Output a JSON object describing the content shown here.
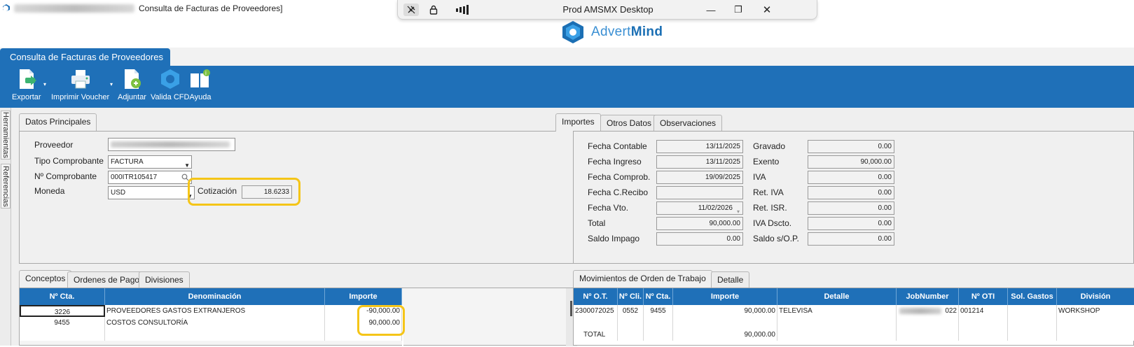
{
  "window": {
    "title": "Consulta de Facturas de Proveedores]"
  },
  "remote_bar": {
    "title": "Prod AMSMX Desktop",
    "minimize": "—",
    "restore": "❐",
    "close": "✕"
  },
  "logo": {
    "part1": "Advert",
    "part2": "Mind"
  },
  "doc_tab": {
    "label": "Consulta de Facturas de Proveedores"
  },
  "toolbar": {
    "exportar": "Exportar",
    "imprimir": "Imprimir Voucher",
    "adjuntar": "Adjuntar",
    "valida": "Valida CFD",
    "ayuda": "Ayuda"
  },
  "side_tabs": {
    "herramientas": "Herramientas",
    "referencias": "Referencias"
  },
  "datos": {
    "tab": "Datos Principales",
    "proveedor_label": "Proveedor",
    "tipo_label": "Tipo Comprobante",
    "tipo_value": "FACTURA",
    "num_label": "Nº Comprobante",
    "num_value": "000ITR105417",
    "moneda_label": "Moneda",
    "moneda_value": "USD",
    "cotizacion_label": "Cotización",
    "cotizacion_value": "18.6233"
  },
  "importes": {
    "tabs": [
      "Importes",
      "Otros Datos",
      "Observaciones"
    ],
    "left": [
      {
        "label": "Fecha Contable",
        "value": "13/11/2025"
      },
      {
        "label": "Fecha Ingreso",
        "value": "13/11/2025"
      },
      {
        "label": "Fecha Comprob.",
        "value": "19/09/2025"
      },
      {
        "label": "Fecha C.Recibo",
        "value": ""
      },
      {
        "label": "Fecha Vto.",
        "value": "11/02/2026"
      },
      {
        "label": "Total",
        "value": "90,000.00"
      },
      {
        "label": "Saldo Impago",
        "value": "0.00"
      }
    ],
    "right": [
      {
        "label": "Gravado",
        "value": "0.00"
      },
      {
        "label": "Exento",
        "value": "90,000.00"
      },
      {
        "label": "IVA",
        "value": "0.00"
      },
      {
        "label": "Ret. IVA",
        "value": "0.00"
      },
      {
        "label": "Ret. ISR.",
        "value": "0.00"
      },
      {
        "label": "IVA Dscto.",
        "value": "0.00"
      },
      {
        "label": "Saldo s/O.P.",
        "value": "0.00"
      }
    ]
  },
  "conceptos": {
    "tabs": [
      "Conceptos",
      "Ordenes de Pago",
      "Divisiones"
    ],
    "headers": [
      "Nº Cta.",
      "Denominación",
      "Importe"
    ],
    "rows": [
      {
        "cta": "3226",
        "denominacion": "PROVEEDORES GASTOS EXTRANJEROS",
        "importe": "-90,000.00"
      },
      {
        "cta": "9455",
        "denominacion": "COSTOS CONSULTORÍA",
        "importe": "90,000.00"
      }
    ]
  },
  "movimientos": {
    "tabs": [
      "Movimientos de Orden de Trabajo",
      "Detalle"
    ],
    "headers": [
      "Nº O.T.",
      "Nº Cli.",
      "Nº Cta.",
      "Importe",
      "Detalle",
      "JobNumber",
      "Nº OTI",
      "Sol. Gastos",
      "División"
    ],
    "rows": [
      {
        "ot": "2300072025",
        "cli": "0552",
        "cta": "9455",
        "importe": "90,000.00",
        "detalle": "TELEVISA",
        "job": "022",
        "oti": "001214",
        "sol": "",
        "division": "WORKSHOP"
      }
    ],
    "total_label": "TOTAL",
    "total_value": "90,000.00"
  }
}
